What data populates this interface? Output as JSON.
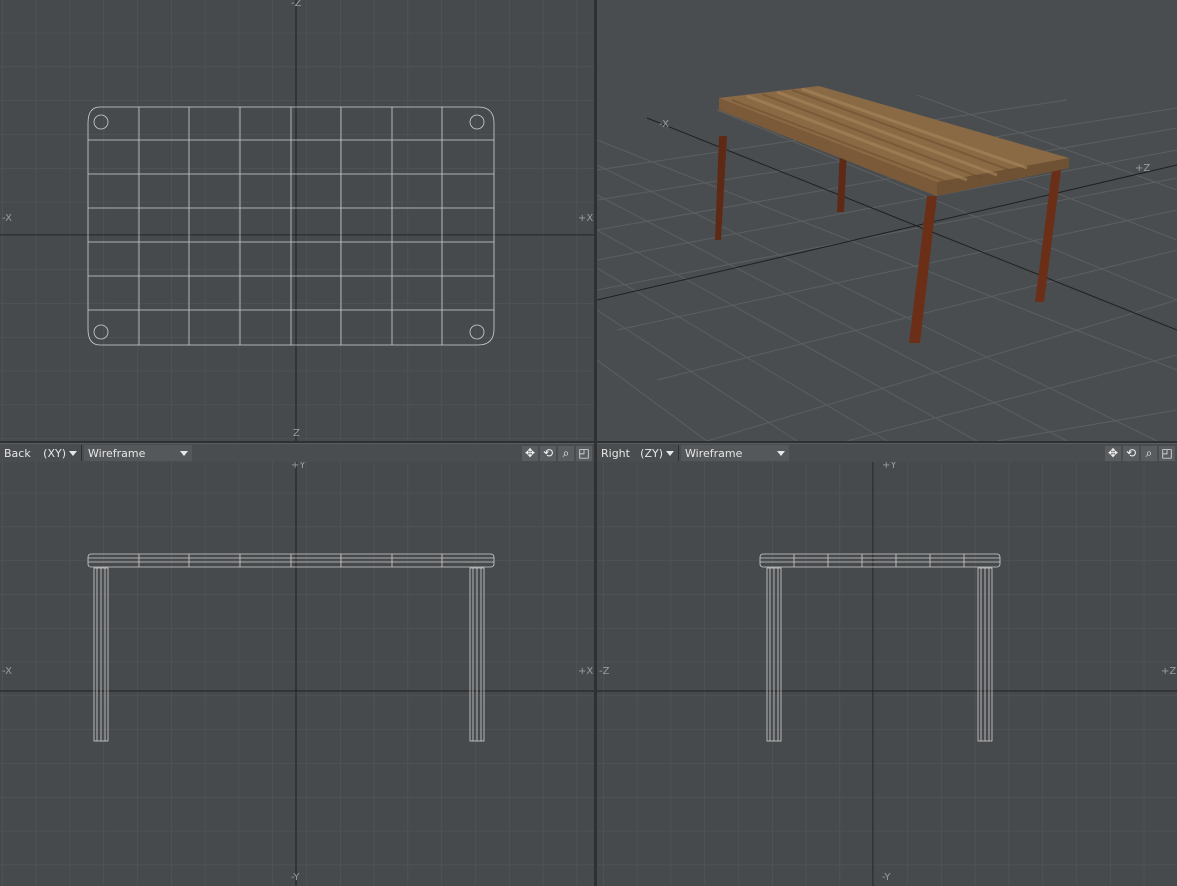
{
  "viewports": {
    "top": {
      "axis_top": "-Z",
      "axis_bottom": "Z",
      "axis_left": "-X",
      "axis_right": "+X"
    },
    "perspective": {
      "axis_x": "-X",
      "axis_z": "+Z"
    },
    "back": {
      "view_label": "Back",
      "plane_label": "(XY)",
      "mode_label": "Wireframe",
      "axis_top": "+Y",
      "axis_bottom": "-Y",
      "axis_left": "-X",
      "axis_right": "+X"
    },
    "right": {
      "view_label": "Right",
      "plane_label": "(ZY)",
      "mode_label": "Wireframe",
      "axis_top": "+Y",
      "axis_bottom": "-Y",
      "axis_left": "-Z",
      "axis_right": "+Z"
    }
  },
  "toolbar_icons": [
    "move-icon",
    "rotate-icon",
    "zoom-icon",
    "maximize-icon"
  ],
  "colors": {
    "viewport_bg": "#474a4d",
    "grid": "#55585b",
    "axis_line": "#1e1f20",
    "wireframe": "#d8d8d8",
    "wood_top": "#8a6a45",
    "legs": "#6b2f18"
  }
}
